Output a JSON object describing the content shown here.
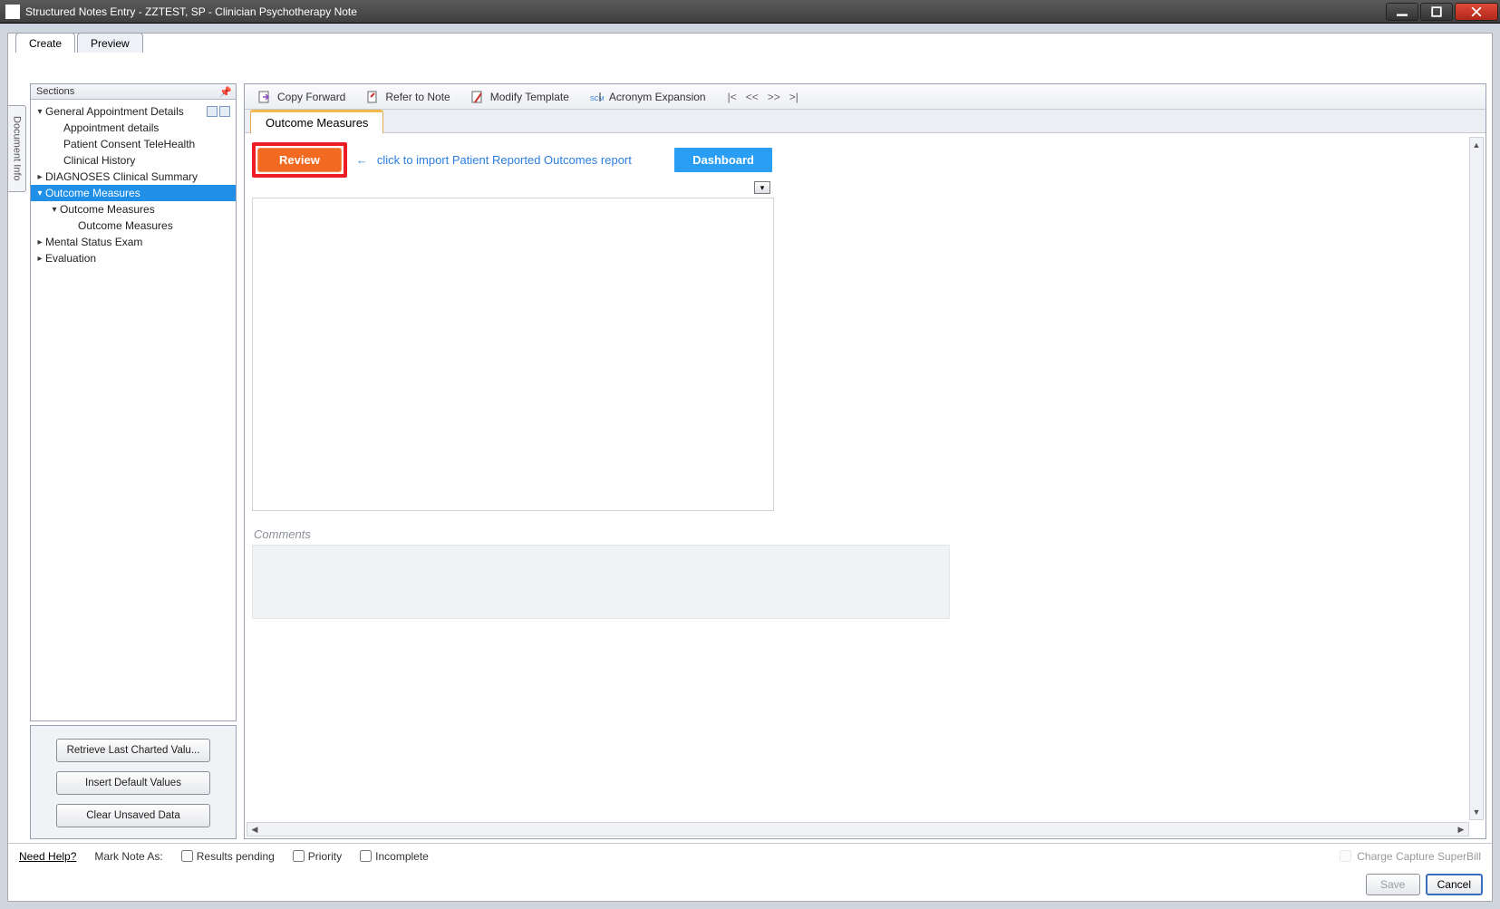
{
  "titlebar": {
    "title": "Structured Notes Entry - ZZTEST, SP - Clinician Psychotherapy Note"
  },
  "tabs": {
    "create": "Create",
    "preview": "Preview"
  },
  "docinfo": "Document Info",
  "sections": {
    "header": "Sections",
    "tree": {
      "general": "General Appointment Details",
      "appointment": "Appointment details",
      "consent": "Patient Consent TeleHealth",
      "clinical": "Clinical History",
      "diagnoses": "DIAGNOSES Clinical Summary",
      "outcome": "Outcome Measures",
      "outcome_sub": "Outcome Measures",
      "outcome_leaf": "Outcome Measures",
      "mental": "Mental Status Exam",
      "evaluation": "Evaluation"
    }
  },
  "left_buttons": {
    "retrieve": "Retrieve Last Charted Valu...",
    "insert": "Insert Default Values",
    "clear": "Clear Unsaved Data"
  },
  "toolbar": {
    "copy": "Copy Forward",
    "refer": "Refer to Note",
    "modify": "Modify Template",
    "acronym": "Acronym Expansion",
    "nav_first": "|<",
    "nav_prev": "<<",
    "nav_next": ">>",
    "nav_last": ">|"
  },
  "content_tab": "Outcome Measures",
  "actions": {
    "review": "Review",
    "arrow": "←",
    "link": "click to import Patient Reported Outcomes report",
    "dashboard": "Dashboard"
  },
  "comments_label": "Comments",
  "footer": {
    "help": "Need Help?",
    "mark": "Mark Note As:",
    "results": "Results pending",
    "priority": "Priority",
    "incomplete": "Incomplete",
    "charge": "Charge Capture SuperBill",
    "save": "Save",
    "cancel": "Cancel"
  }
}
